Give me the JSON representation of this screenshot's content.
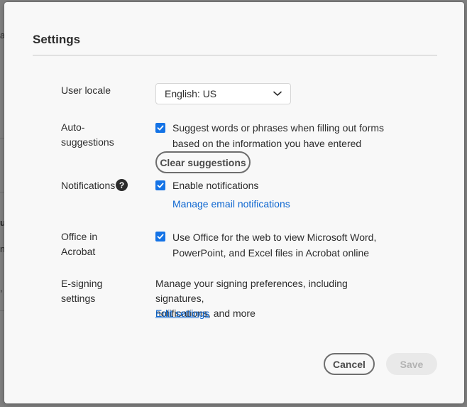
{
  "background": {
    "fragments": [
      "a",
      "u",
      "n",
      ","
    ]
  },
  "dialog": {
    "title": "Settings",
    "user_locale": {
      "label": "User locale",
      "selected": "English: US"
    },
    "auto_suggestions": {
      "label_line1": "Auto-",
      "label_line2": "suggestions",
      "checked": true,
      "text_line1": "Suggest words or phrases when filling out forms",
      "text_line2": "based on the information you have entered",
      "clear_button": "Clear suggestions"
    },
    "notifications": {
      "label": "Notifications",
      "help_glyph": "?",
      "checked": true,
      "enable_text": "Enable notifications",
      "manage_link": "Manage email notifications"
    },
    "office": {
      "label_line1": "Office in",
      "label_line2": "Acrobat",
      "checked": true,
      "text_line1": "Use Office for the web to view Microsoft Word,",
      "text_line2": "PowerPoint, and Excel files in Acrobat online"
    },
    "esigning": {
      "label_line1": "E-signing",
      "label_line2": "settings",
      "text_line1": "Manage your signing preferences, including signatures,",
      "text_line2": "notifications, and more",
      "edit_link": "Edit settings"
    },
    "footer": {
      "cancel": "Cancel",
      "save": "Save"
    }
  },
  "colors": {
    "accent": "#1473e6",
    "link": "#0d66d0",
    "text": "#2c2c2c"
  }
}
